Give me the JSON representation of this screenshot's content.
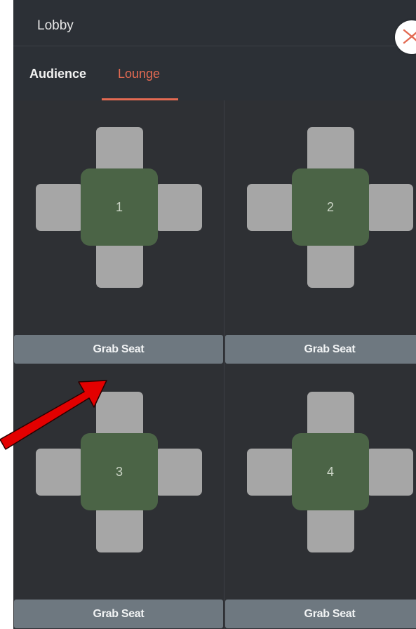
{
  "header": {
    "title": "Lobby"
  },
  "tabs": [
    {
      "label": "Audience",
      "active": false
    },
    {
      "label": "Lounge",
      "active": true
    }
  ],
  "tables": [
    {
      "number": "1",
      "button_label": "Grab Seat"
    },
    {
      "number": "2",
      "button_label": "Grab Seat"
    },
    {
      "number": "3",
      "button_label": "Grab Seat"
    },
    {
      "number": "4",
      "button_label": "Grab Seat"
    }
  ],
  "colors": {
    "accent": "#e36a52",
    "table": "#4b6446",
    "seat": "#a6a6a6",
    "button": "#6e7880",
    "panel": "#2c2f33",
    "annotation_arrow": "#e30000"
  },
  "icons": {
    "close": "close-icon",
    "annotation": "red-arrow-annotation"
  }
}
